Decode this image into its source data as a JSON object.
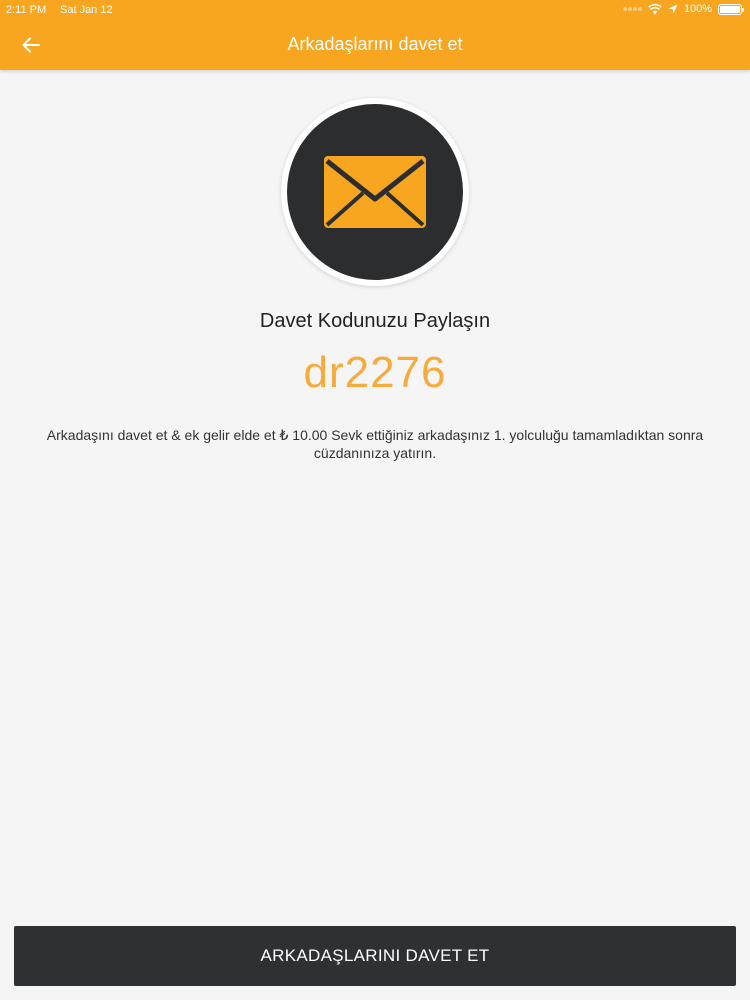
{
  "status_bar": {
    "time": "2:11 PM",
    "date": "Sat Jan 12",
    "battery": "100%"
  },
  "app_bar": {
    "title": "Arkadaşlarını davet et",
    "back_icon": "arrow-left-icon"
  },
  "hero": {
    "icon": "envelope-icon"
  },
  "content": {
    "share_title": "Davet Kodunuzu Paylaşın",
    "code": "dr2276",
    "description": "Arkadaşını davet et & ek gelir elde et ₺ 10.00 Sevk ettiğiniz arkadaşınız 1. yolculuğu tamamladıktan sonra cüzdanınıza yatırın."
  },
  "footer": {
    "button_label": "ARKADAŞLARINI DAVET ET"
  },
  "colors": {
    "accent": "#f8a620",
    "code": "#f7ab3d",
    "dark": "#2e3033",
    "background": "#f5f5f5"
  }
}
